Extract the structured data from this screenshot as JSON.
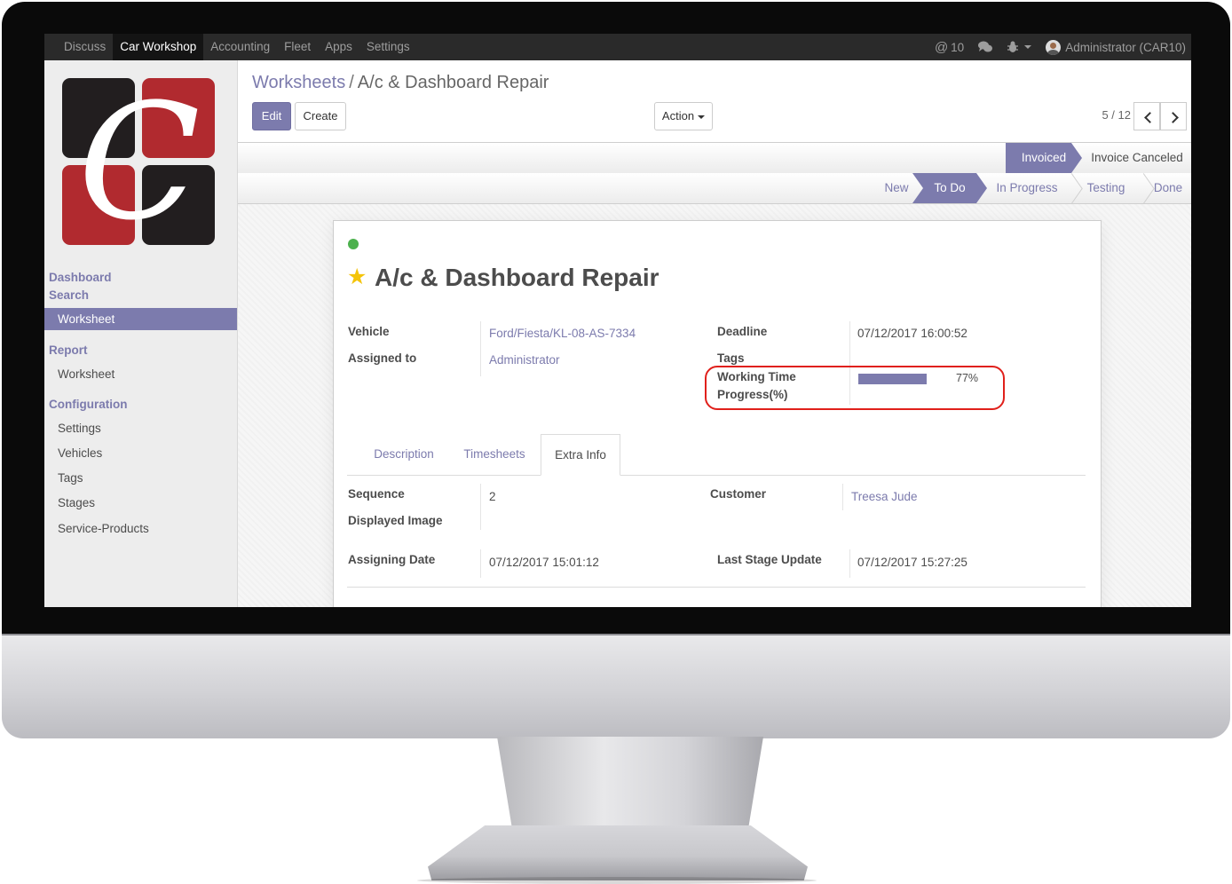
{
  "topbar": {
    "menu": [
      "Discuss",
      "Car Workshop",
      "Accounting",
      "Fleet",
      "Apps",
      "Settings"
    ],
    "active_menu": "Car Workshop",
    "notifications": "10",
    "user": "Administrator (CAR10)",
    "icons": [
      "at-icon",
      "chat-icon",
      "bug-icon",
      "avatar"
    ]
  },
  "sidebar": {
    "sections": [
      {
        "title": "Dashboard",
        "items": []
      },
      {
        "title": "Search",
        "items": [
          "Worksheet"
        ]
      },
      {
        "title": "Report",
        "items": [
          "Worksheet"
        ]
      },
      {
        "title": "Configuration",
        "items": [
          "Settings",
          "Vehicles",
          "Tags",
          "Stages",
          "Service-Products"
        ]
      }
    ],
    "active_item": "Worksheet"
  },
  "control_panel": {
    "breadcrumb_parent": "Worksheets",
    "breadcrumb_sep": "/",
    "breadcrumb_current": "A/c & Dashboard Repair",
    "edit_label": "Edit",
    "create_label": "Create",
    "action_label": "Action",
    "pager": "5 / 12"
  },
  "invoice_status": {
    "stages": [
      "Invoiced",
      "Invoice Canceled"
    ],
    "active": "Invoiced"
  },
  "stage_status": {
    "stages": [
      "New",
      "To Do",
      "In Progress",
      "Testing",
      "Done"
    ],
    "active": "To Do"
  },
  "form": {
    "title": "A/c & Dashboard Repair",
    "kanban_state_color": "#4cb14d",
    "vehicle_label": "Vehicle",
    "vehicle_value": "Ford/Fiesta/KL-08-AS-7334",
    "assigned_label": "Assigned to",
    "assigned_value": "Administrator",
    "deadline_label": "Deadline",
    "deadline_value": "07/12/2017 16:00:52",
    "tags_label": "Tags",
    "progress_label_1": "Working Time",
    "progress_label_2": "Progress(%)",
    "progress_value": 77,
    "progress_text": "77%",
    "tabs": [
      "Description",
      "Timesheets",
      "Extra Info"
    ],
    "active_tab": "Extra Info",
    "sequence_label": "Sequence",
    "sequence_value": "2",
    "displayed_image_label": "Displayed Image",
    "customer_label": "Customer",
    "customer_value": "Treesa Jude",
    "assigning_date_label": "Assigning Date",
    "assigning_date_value": "07/12/2017 15:01:12",
    "last_stage_update_label": "Last Stage Update",
    "last_stage_update_value": "07/12/2017 15:27:25"
  },
  "colors": {
    "accent": "#7c7bad",
    "topbar": "#2a2a2a",
    "highlight": "#e0201b",
    "logo_red": "#b12a2f",
    "logo_dark": "#221e1f"
  }
}
